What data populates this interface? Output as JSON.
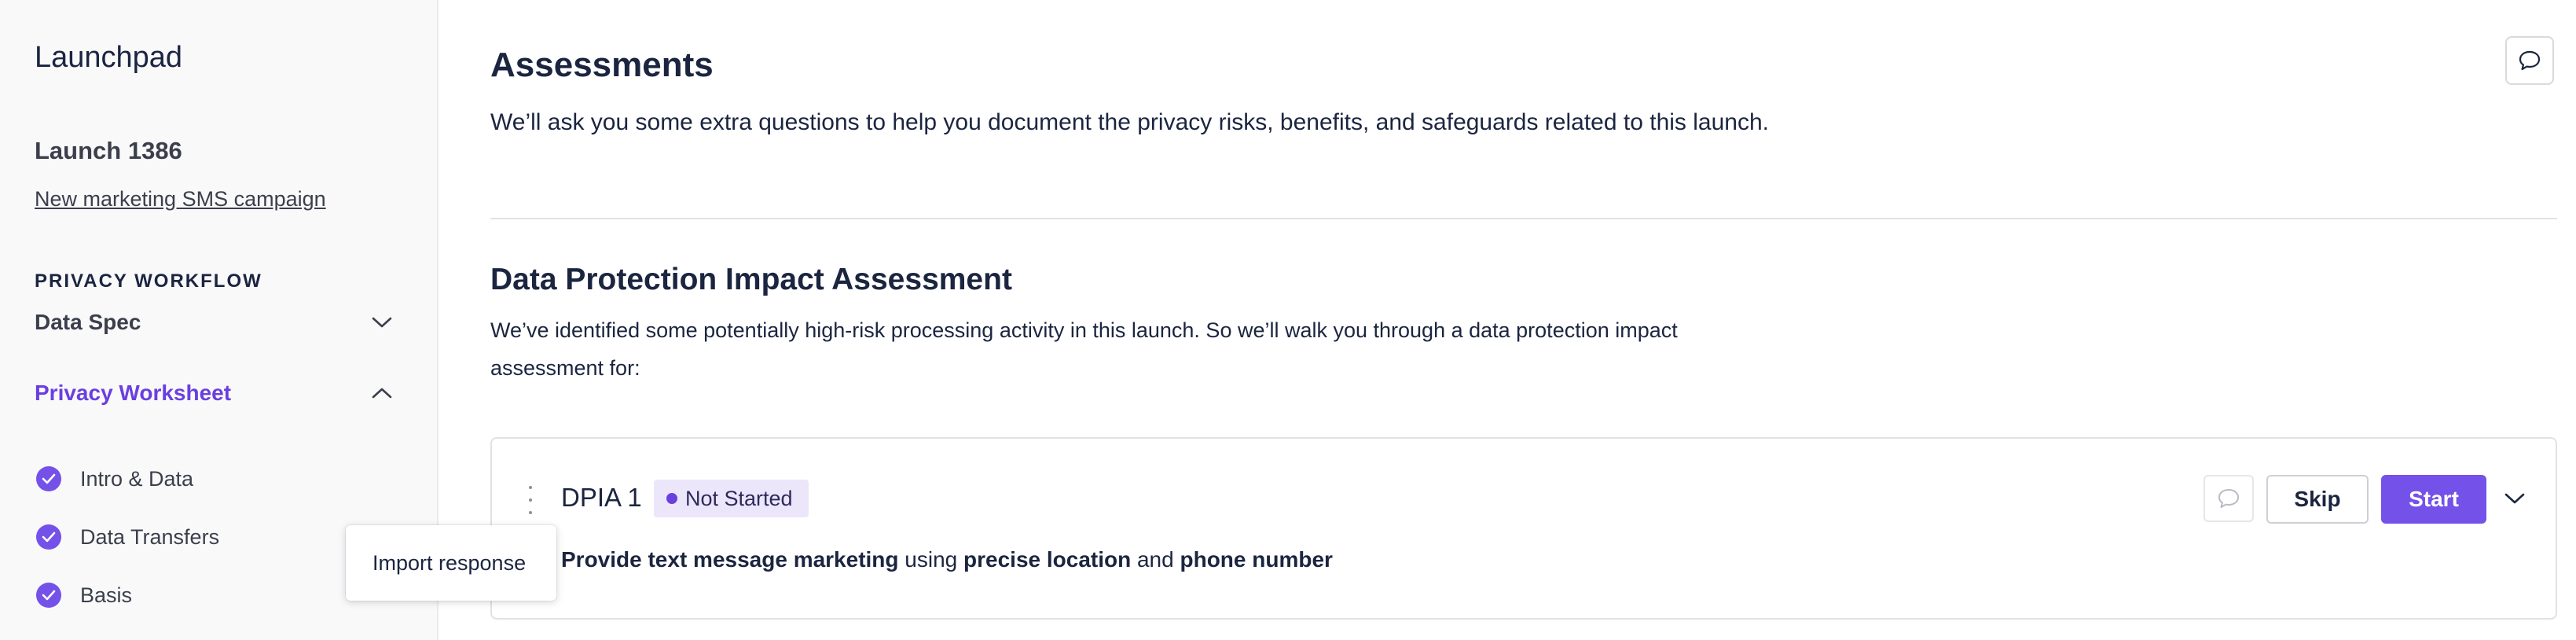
{
  "sidebar": {
    "app_title": "Launchpad",
    "launch_title": "Launch 1386",
    "launch_link": "New marketing SMS campaign",
    "section_label": "PRIVACY WORKFLOW",
    "items": [
      {
        "label": "Data Spec",
        "expanded": false
      },
      {
        "label": "Privacy Worksheet",
        "expanded": true,
        "active": true
      }
    ],
    "sub_items": [
      {
        "label": "Intro & Data",
        "completed": true
      },
      {
        "label": "Data Transfers",
        "completed": true
      },
      {
        "label": "Basis",
        "completed": true
      }
    ]
  },
  "popover": {
    "label": "Import response"
  },
  "main": {
    "title": "Assessments",
    "description": "We’ll ask you some extra questions to help you document the privacy risks, benefits, and safeguards related to this launch.",
    "section": {
      "title": "Data Protection Impact Assessment",
      "description": "We’ve identified some potentially high-risk processing activity in this launch. So we’ll walk you through a data protection impact assessment for:"
    },
    "card": {
      "name": "DPIA 1",
      "status": "Not Started",
      "skip_label": "Skip",
      "start_label": "Start",
      "summary": {
        "activity": "Provide text message marketing",
        "using": "using",
        "data1": "precise location",
        "and": "and",
        "data2": "phone number"
      }
    }
  },
  "icons": {
    "comment": "comment-icon",
    "chevron_down": "chevron-down-icon",
    "chevron_up": "chevron-up-icon",
    "check": "check-circle-icon",
    "kebab": "kebab-menu-icon"
  },
  "colors": {
    "accent": "#7451e8",
    "accent_text": "#6a3fe0",
    "badge_bg": "#ece6fb",
    "text": "#1b2540",
    "sidebar_bg": "#f9f9fa"
  }
}
